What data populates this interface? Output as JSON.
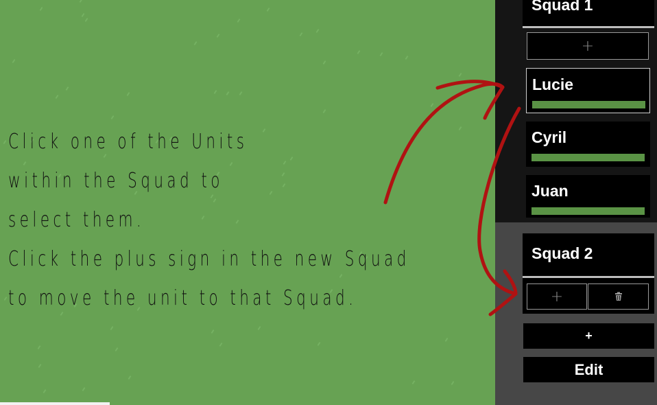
{
  "tutorial": {
    "lines": [
      "Click one of the Units",
      "within the Squad to",
      "select them.",
      "Click the plus sign in the new Squad",
      "to move the unit to that Squad."
    ]
  },
  "squads": [
    {
      "title": "Squad 1",
      "add_symbol": "+",
      "units": [
        {
          "name": "Lucie",
          "health": 1.0,
          "selected": true
        },
        {
          "name": "Cyril",
          "health": 1.0,
          "selected": false
        },
        {
          "name": "Juan",
          "health": 1.0,
          "selected": false
        }
      ]
    },
    {
      "title": "Squad 2",
      "add_symbol": "+",
      "delete_icon": "trash-icon"
    }
  ],
  "panel": {
    "add_squad_label": "+",
    "edit_label": "Edit"
  },
  "colors": {
    "field": "#67a253",
    "health_bar": "#5a9345",
    "arrow": "#b01212",
    "panel_dark": "#151515",
    "panel_gray": "#474747"
  }
}
